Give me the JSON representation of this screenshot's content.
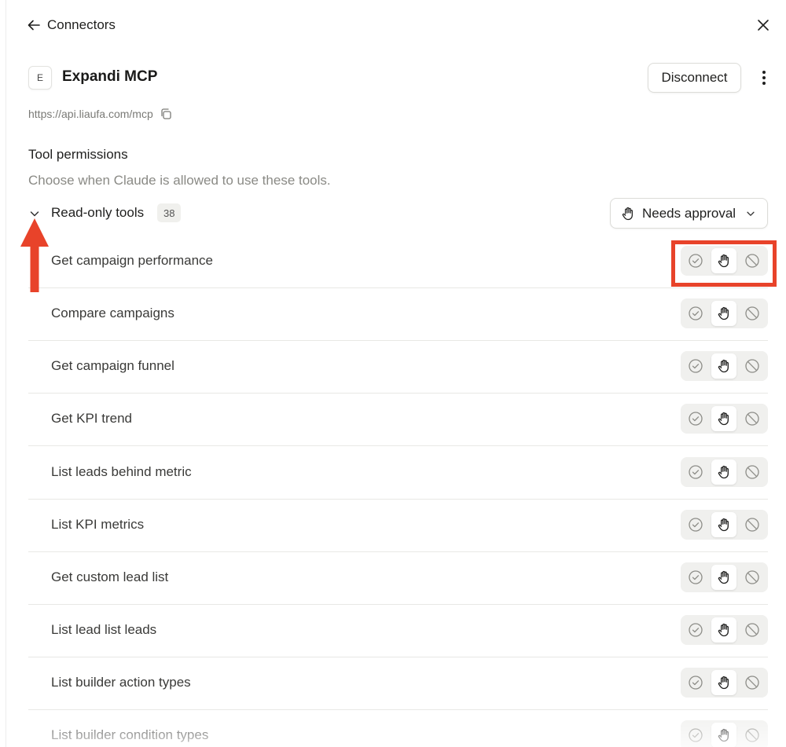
{
  "nav": {
    "back_label": "Connectors"
  },
  "connector": {
    "logo_letter": "E",
    "name": "Expandi MCP",
    "disconnect_label": "Disconnect",
    "url": "https://api.liaufa.com/mcp"
  },
  "permissions": {
    "title": "Tool permissions",
    "description": "Choose when Claude is allowed to use these tools."
  },
  "group": {
    "label": "Read-only tools",
    "count": "38",
    "default_policy": "Needs approval",
    "default_policy_icon": "hand-icon"
  },
  "tools": [
    {
      "name": "Get campaign performance",
      "selected": "needs-approval"
    },
    {
      "name": "Compare campaigns",
      "selected": "needs-approval"
    },
    {
      "name": "Get campaign funnel",
      "selected": "needs-approval"
    },
    {
      "name": "Get KPI trend",
      "selected": "needs-approval"
    },
    {
      "name": "List leads behind metric",
      "selected": "needs-approval"
    },
    {
      "name": "List KPI metrics",
      "selected": "needs-approval"
    },
    {
      "name": "Get custom lead list",
      "selected": "needs-approval"
    },
    {
      "name": "List lead list leads",
      "selected": "needs-approval"
    },
    {
      "name": "List builder action types",
      "selected": "needs-approval"
    },
    {
      "name": "List builder condition types",
      "selected": "needs-approval"
    }
  ],
  "colors": {
    "annotation": "#e8432a",
    "row_divider": "#e8e8e5",
    "segment_bg": "#f0f0ee",
    "muted_text": "#8a8a85"
  }
}
